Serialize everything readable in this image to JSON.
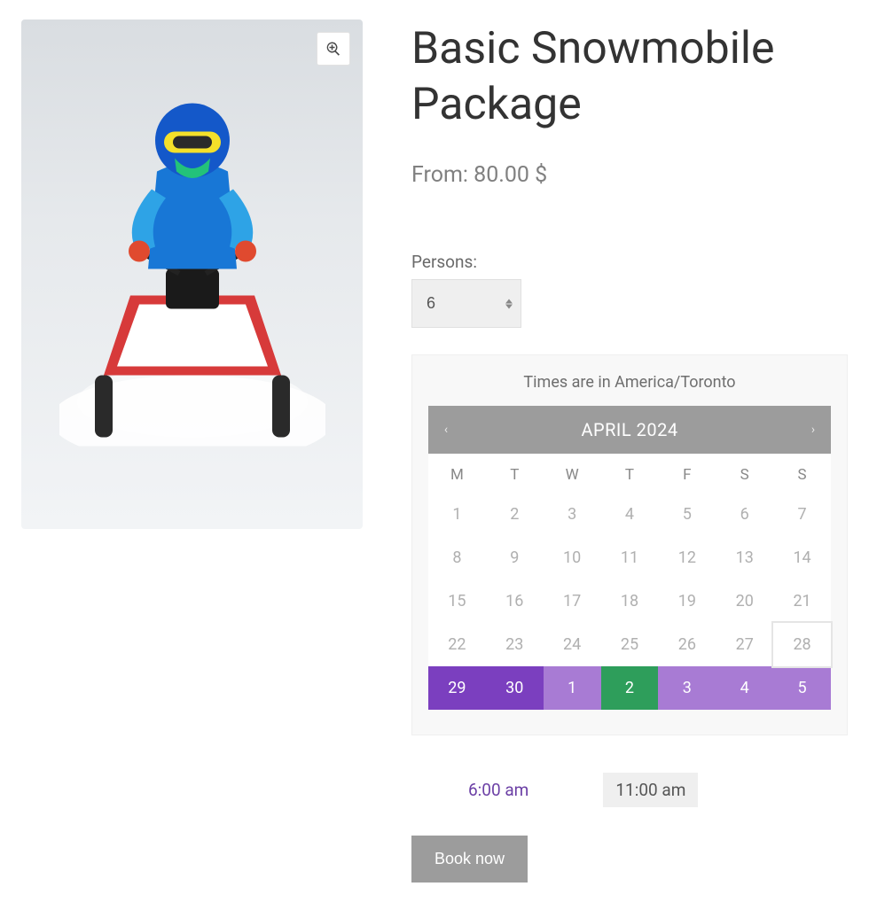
{
  "product": {
    "title": "Basic Snowmobile Package",
    "price_line": "From: 80.00 $",
    "image_alt": "Person riding a red and white snowmobile"
  },
  "zoom_icon": "zoom-in",
  "persons": {
    "label": "Persons:",
    "value": "6"
  },
  "calendar": {
    "timezone_note": "Times are in America/Toronto",
    "month_label": "APRIL 2024",
    "prev_icon": "‹",
    "next_icon": "›",
    "dow": [
      "M",
      "T",
      "W",
      "T",
      "F",
      "S",
      "S"
    ],
    "days": [
      {
        "n": "1",
        "cls": ""
      },
      {
        "n": "2",
        "cls": ""
      },
      {
        "n": "3",
        "cls": ""
      },
      {
        "n": "4",
        "cls": ""
      },
      {
        "n": "5",
        "cls": ""
      },
      {
        "n": "6",
        "cls": ""
      },
      {
        "n": "7",
        "cls": ""
      },
      {
        "n": "8",
        "cls": ""
      },
      {
        "n": "9",
        "cls": ""
      },
      {
        "n": "10",
        "cls": ""
      },
      {
        "n": "11",
        "cls": ""
      },
      {
        "n": "12",
        "cls": ""
      },
      {
        "n": "13",
        "cls": ""
      },
      {
        "n": "14",
        "cls": ""
      },
      {
        "n": "15",
        "cls": ""
      },
      {
        "n": "16",
        "cls": ""
      },
      {
        "n": "17",
        "cls": ""
      },
      {
        "n": "18",
        "cls": ""
      },
      {
        "n": "19",
        "cls": ""
      },
      {
        "n": "20",
        "cls": ""
      },
      {
        "n": "21",
        "cls": ""
      },
      {
        "n": "22",
        "cls": ""
      },
      {
        "n": "23",
        "cls": ""
      },
      {
        "n": "24",
        "cls": ""
      },
      {
        "n": "25",
        "cls": ""
      },
      {
        "n": "26",
        "cls": ""
      },
      {
        "n": "27",
        "cls": ""
      },
      {
        "n": "28",
        "cls": "today"
      },
      {
        "n": "29",
        "cls": "avail-dark"
      },
      {
        "n": "30",
        "cls": "avail-dark"
      },
      {
        "n": "1",
        "cls": "avail-light"
      },
      {
        "n": "2",
        "cls": "selected"
      },
      {
        "n": "3",
        "cls": "avail-light"
      },
      {
        "n": "4",
        "cls": "avail-light"
      },
      {
        "n": "5",
        "cls": "avail-light"
      }
    ]
  },
  "slots": [
    {
      "label": "6:00 am",
      "active": false
    },
    {
      "label": "11:00 am",
      "active": true
    }
  ],
  "book_button": "Book now"
}
